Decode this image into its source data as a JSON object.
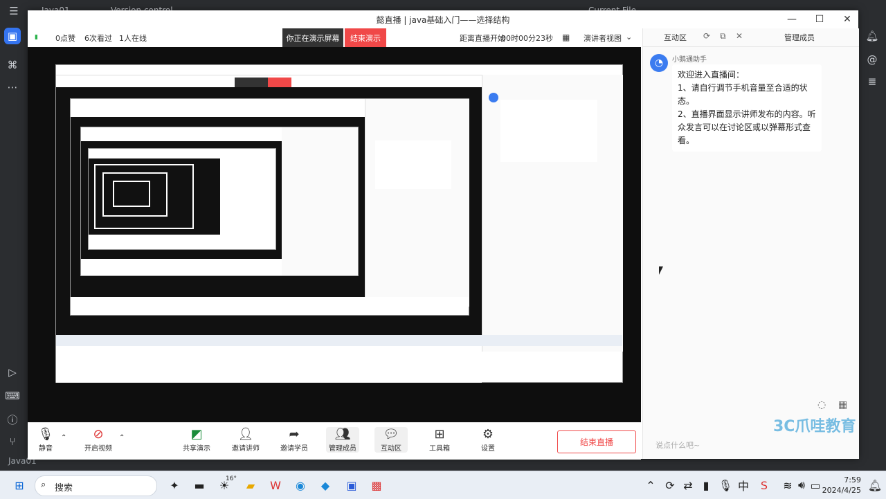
{
  "ide": {
    "project": "Java01",
    "vcs": "Version control",
    "run_config": "Current File",
    "bottom_project": "Java01"
  },
  "window": {
    "title": "懿直播 | java基础入门——选择结构",
    "minimize": "—",
    "maximize": "☐",
    "close": "✕"
  },
  "status": {
    "likes": "0点赞",
    "views": "6次看过",
    "online": "1人在线",
    "presenting": "你正在演示屏幕",
    "end_demo": "结束演示",
    "countdown_label": "距离直播开始",
    "countdown": "00时00分23秒",
    "view_mode": "演讲者视图"
  },
  "panel": {
    "tab_interact": "互动区",
    "tab_members": "管理成员",
    "sender": "小鹅通助手",
    "message": [
      "欢迎进入直播间：",
      "1、请自行调节手机音量至合适的状态。",
      "2、直播界面显示讲师发布的内容。听众发言可以在讨论区或以弹幕形式查看。"
    ],
    "input_placeholder": "说点什么吧~",
    "brand": "爪哇教育"
  },
  "toolbar": {
    "mute": "静音",
    "video": "开启视频",
    "share": "共享演示",
    "invite_teacher": "邀请讲师",
    "invite_student": "邀请学员",
    "members": "管理成员",
    "interact": "互动区",
    "tools": "工具箱",
    "settings": "设置",
    "end_live": "结束直播"
  },
  "taskbar": {
    "search": "搜索",
    "time": "7:59",
    "date": "2024/4/25",
    "weather": "16°"
  },
  "colors": {
    "accent_red": "#f04848",
    "accent_blue": "#3b7cf0",
    "ide_dark": "#2b2d30"
  }
}
